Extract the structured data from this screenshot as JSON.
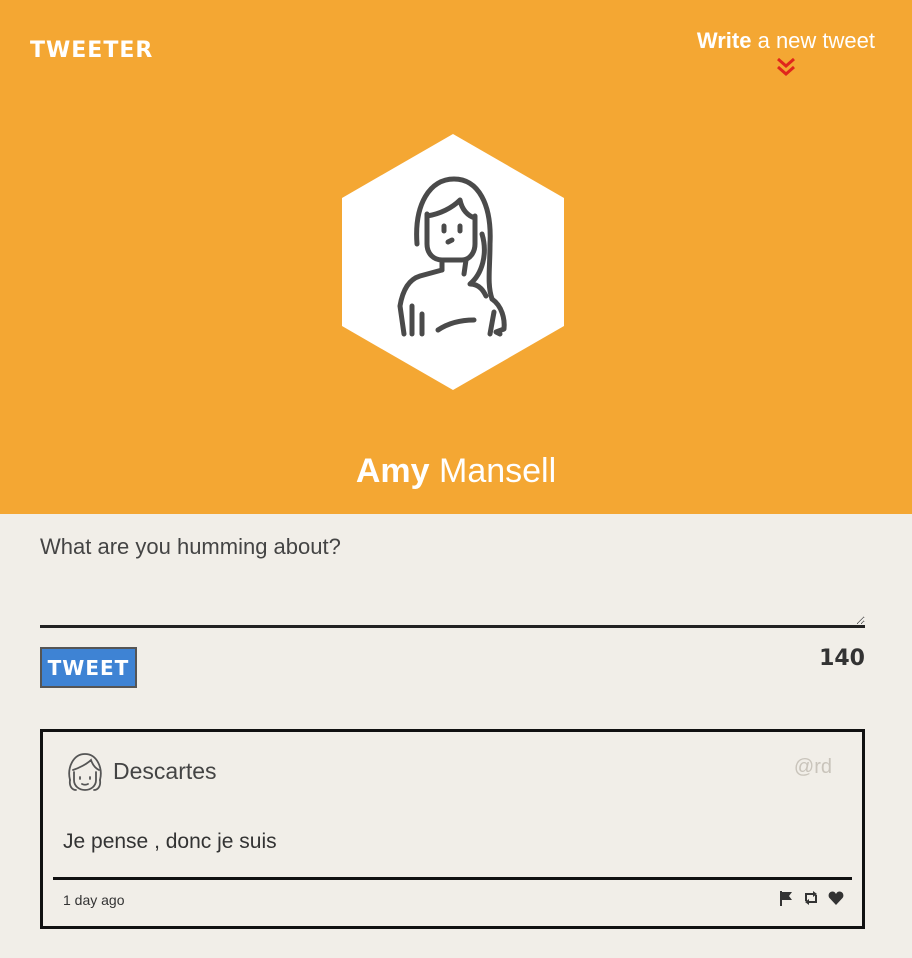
{
  "header": {
    "logo": "TWEETER",
    "compose_bold": "Write",
    "compose_rest": " a new tweet",
    "profile_first": "Amy",
    "profile_last": " Mansell"
  },
  "composer": {
    "placeholder": "What are you humming about?",
    "value": "",
    "tweet_button": "TWEET",
    "counter": "140"
  },
  "tweets": [
    {
      "user_name": "Descartes",
      "handle": "@rd",
      "text": "Je pense , donc je suis",
      "time": "1 day ago",
      "actions": [
        "flag-icon",
        "retweet-icon",
        "heart-icon"
      ]
    }
  ],
  "colors": {
    "header_bg": "#f4a733",
    "page_bg": "#f1eee8",
    "tweet_button_bg": "#3e83d4",
    "chevron": "#e0261c"
  }
}
